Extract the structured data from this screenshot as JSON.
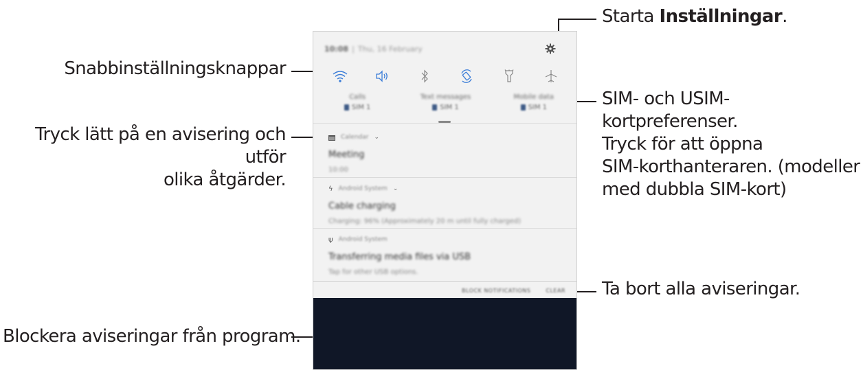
{
  "callouts": {
    "settings_prefix": "Starta ",
    "settings_bold": "Inställningar",
    "settings_suffix": ".",
    "quick_settings": "Snabbinställningsknappar",
    "sim_line1": "SIM- och USIM-kortpreferenser.",
    "sim_line2": "Tryck för att öppna",
    "sim_line3": "SIM-korthanteraren. (modeller",
    "sim_line4": "med dubbla SIM-kort)",
    "tap_notif_line1": "Tryck lätt på en avisering och utför",
    "tap_notif_line2": "olika åtgärder.",
    "clear_all": "Ta bort alla aviseringar.",
    "block": "Blockera aviseringar från program."
  },
  "panel": {
    "status_time": "10:08",
    "status_date": "Thu, 16 February",
    "quick_buttons": [
      "wifi-icon",
      "sound-icon",
      "bluetooth-icon",
      "auto-rotate-icon",
      "flashlight-icon",
      "airplane-icon"
    ],
    "sim_prefs": [
      {
        "name": "Calls",
        "sim": "SIM 1"
      },
      {
        "name": "Text messages",
        "sim": "SIM 1"
      },
      {
        "name": "Mobile data",
        "sim": "SIM 1"
      }
    ],
    "notifications": [
      {
        "app": "Calendar",
        "title": "Meeting",
        "body": "10:00"
      },
      {
        "app": "Android System",
        "title": "Cable charging",
        "body": "Charging: 96% (Approximately 20 m until fully charged)"
      },
      {
        "app": "Android System",
        "title": "Transferring media files via USB",
        "body": "Tap for other USB options."
      }
    ],
    "block_label": "BLOCK NOTIFICATIONS",
    "clear_label": "CLEAR"
  },
  "colors": {
    "icon_blue": "#3b7dd8",
    "dark_background": "#101727",
    "panel_background": "#f2f2f2"
  }
}
